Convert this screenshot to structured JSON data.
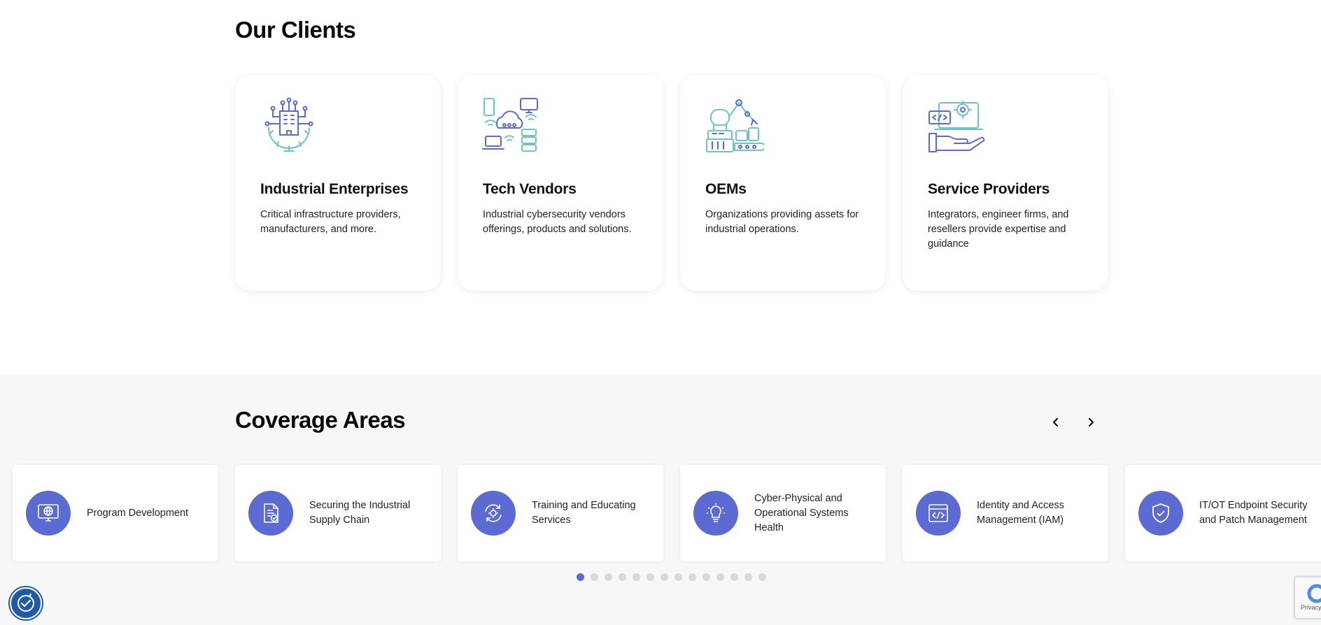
{
  "clients": {
    "title": "Our Clients",
    "cards": [
      {
        "icon": "industrial-gear-building-icon",
        "title": "Industrial Enterprises",
        "text": "Critical infrastructure providers, manufacturers, and more."
      },
      {
        "icon": "network-devices-cloud-icon",
        "title": "Tech Vendors",
        "text": "Industrial cybersecurity vendors offerings, products and solutions."
      },
      {
        "icon": "robotic-arm-icon",
        "title": "OEMs",
        "text": "Organizations providing assets for industrial operations."
      },
      {
        "icon": "hand-laptop-code-icon",
        "title": "Service Providers",
        "text": "Integrators, engineer firms, and resellers provide expertise and guidance"
      }
    ]
  },
  "coverage": {
    "title": "Coverage Areas",
    "items": [
      {
        "icon": "globe-monitor-icon",
        "label": "Program Development"
      },
      {
        "icon": "document-check-icon",
        "label": "Securing the Industrial Supply Chain"
      },
      {
        "icon": "gear-refresh-icon",
        "label": "Training and Educating Services"
      },
      {
        "icon": "lightbulb-icon",
        "label": "Cyber-Physical and Operational Systems Health"
      },
      {
        "icon": "code-window-icon",
        "label": "Identity and Access Management (IAM)"
      },
      {
        "icon": "shield-check-icon",
        "label": "IT/OT Endpoint Security and Patch Management"
      }
    ],
    "pagination": {
      "total": 14,
      "active": 0
    }
  },
  "colors": {
    "accent": "#5b6bd2",
    "teal": "#6fc3c0",
    "section_bg": "#f7f7f7"
  },
  "recaptcha": {
    "text": "Privacy -"
  }
}
